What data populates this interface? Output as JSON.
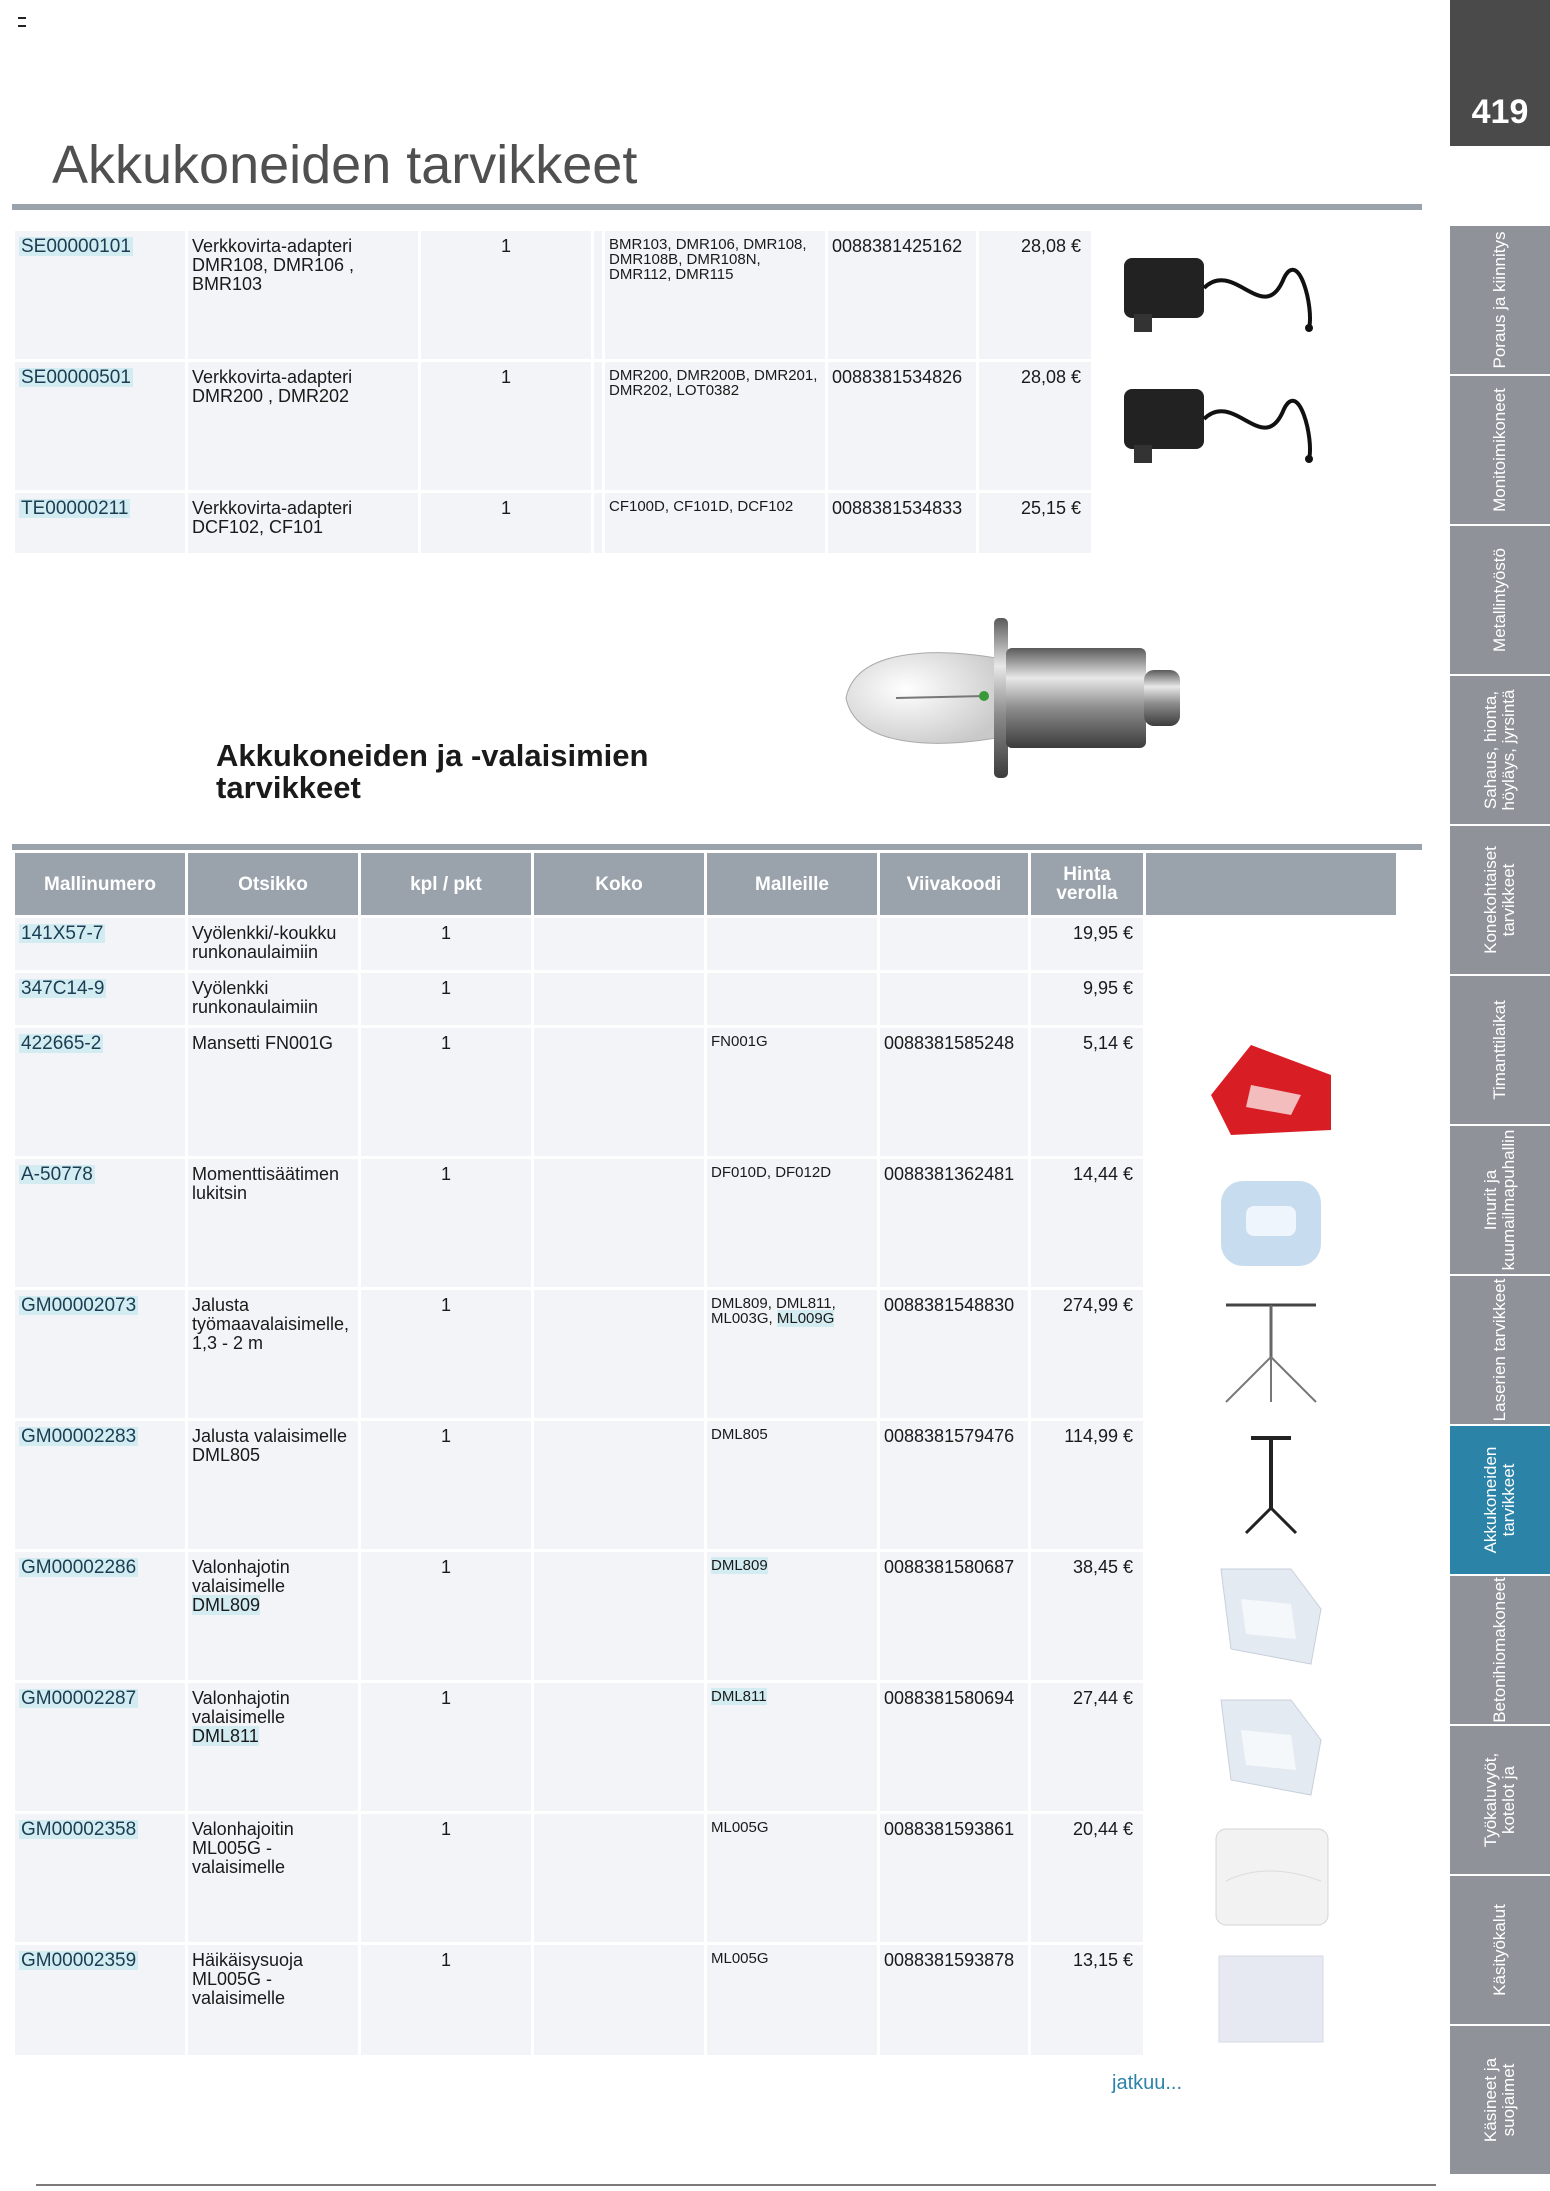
{
  "page_number": "419",
  "title": "Akkukoneiden tarvikkeet",
  "section1_rows": [
    {
      "code": "SE00000101",
      "title": "Verkkovirta-adapteri DMR108, DMR106 , BMR103",
      "qty": "1",
      "models": "BMR103, DMR106, DMR108, DMR108B, DMR108N, DMR112, DMR115",
      "barcode": "0088381425162",
      "price": "28,08 €",
      "image": "power-adapter-image"
    },
    {
      "code": "SE00000501",
      "title": "Verkkovirta-adapteri DMR200 , DMR202",
      "qty": "1",
      "models": "DMR200, DMR200B, DMR201, DMR202, LOT0382",
      "barcode": "0088381534826",
      "price": "28,08 €",
      "image": "power-adapter-image"
    },
    {
      "code": "TE00000211",
      "title": "Verkkovirta-adapteri DCF102, CF101",
      "qty": "1",
      "models": "CF100D, CF101D, DCF102",
      "barcode": "0088381534833",
      "price": "25,15 €",
      "image": ""
    }
  ],
  "subheading_line1": "Akkukoneiden ja -valaisimien",
  "subheading_line2": "tarvikkeet",
  "table_headers": {
    "mallinumero": "Mallinumero",
    "otsikko": "Otsikko",
    "kpl": "kpl / pkt",
    "koko": "Koko",
    "malleille": "Malleille",
    "viivakoodi": "Viivakoodi",
    "hinta_line1": "Hinta",
    "hinta_line2": "verolla"
  },
  "section2_rows": [
    {
      "code": "141X57-7",
      "title": "Vyölenkki/-koukku runkonaulaimiin",
      "qty": "1",
      "koko": "",
      "models": "",
      "models_hl": "",
      "barcode": "",
      "price": "19,95 €"
    },
    {
      "code": "347C14-9",
      "title": "Vyölenkki runkonaulaimiin",
      "qty": "1",
      "koko": "",
      "models": "",
      "models_hl": "",
      "barcode": "",
      "price": "9,95 €"
    },
    {
      "code": "422665-2",
      "title": "Mansetti FN001G",
      "qty": "1",
      "koko": "",
      "models": "FN001G",
      "models_hl": "",
      "barcode": "0088381585248",
      "price": "5,14 €"
    },
    {
      "code": "A-50778",
      "title": "Momenttisäätimen lukitsin",
      "qty": "1",
      "koko": "",
      "models": "DF010D, DF012D",
      "models_hl": "",
      "barcode": "0088381362481",
      "price": "14,44 €"
    },
    {
      "code": "GM00002073",
      "title": "Jalusta työmaavalaisimelle, 1,3 - 2 m",
      "qty": "1",
      "koko": "",
      "models": "DML809, DML811, ML003G,",
      "models_hl": "ML009G",
      "barcode": "0088381548830",
      "price": "274,99 €"
    },
    {
      "code": "GM00002283",
      "title": "Jalusta valaisimelle DML805",
      "qty": "1",
      "koko": "",
      "models": "DML805",
      "models_hl": "",
      "barcode": "0088381579476",
      "price": "114,99 €"
    },
    {
      "code": "GM00002286",
      "title": "Valonhajotin valaisimelle",
      "title_hl": "DML809",
      "qty": "1",
      "koko": "",
      "models": "",
      "models_hl": "DML809",
      "barcode": "0088381580687",
      "price": "38,45 €"
    },
    {
      "code": "GM00002287",
      "title": "Valonhajotin valaisimelle",
      "title_hl": "DML811",
      "qty": "1",
      "koko": "",
      "models": "",
      "models_hl": "DML811",
      "barcode": "0088381580694",
      "price": "27,44 €"
    },
    {
      "code": "GM00002358",
      "title": "Valonhajoitin ML005G - valaisimelle",
      "qty": "1",
      "koko": "",
      "models": "ML005G",
      "models_hl": "",
      "barcode": "0088381593861",
      "price": "20,44 €"
    },
    {
      "code": "GM00002359",
      "title": "Häikäisysuoja ML005G - valaisimelle",
      "qty": "1",
      "koko": "",
      "models": "ML005G",
      "models_hl": "",
      "barcode": "0088381593878",
      "price": "13,15 €"
    }
  ],
  "continued": "jatkuu...",
  "side_tabs": [
    {
      "label": "Poraus ja kiinnitys",
      "active": false
    },
    {
      "label": "Monitoimikoneet",
      "active": false
    },
    {
      "label": "Metallintyöstö",
      "active": false
    },
    {
      "label": "Sahaus, hionta, höyläys, jyrsintä",
      "active": false
    },
    {
      "label": "Konekohtaiset tarvikkeet",
      "active": false
    },
    {
      "label": "Timanttilaikat",
      "active": false
    },
    {
      "label": "Imurit ja kuumailmapuhallin",
      "active": false
    },
    {
      "label": "Laserien tarvikkeet",
      "active": false
    },
    {
      "label": "Akkukoneiden tarvikkeet",
      "active": true
    },
    {
      "label": "Betonihiomakoneet",
      "active": false
    },
    {
      "label": "Työkaluvyöt, kotelot ja",
      "active": false
    },
    {
      "label": "Käsityökalut",
      "active": false
    },
    {
      "label": "Käsineet ja suojaimet",
      "active": false
    }
  ],
  "colors": {
    "accent": "#2b83a8",
    "tab_gray": "#8f9399",
    "header_gray": "#9aa3ac",
    "highlight": "#d3ecf2"
  }
}
